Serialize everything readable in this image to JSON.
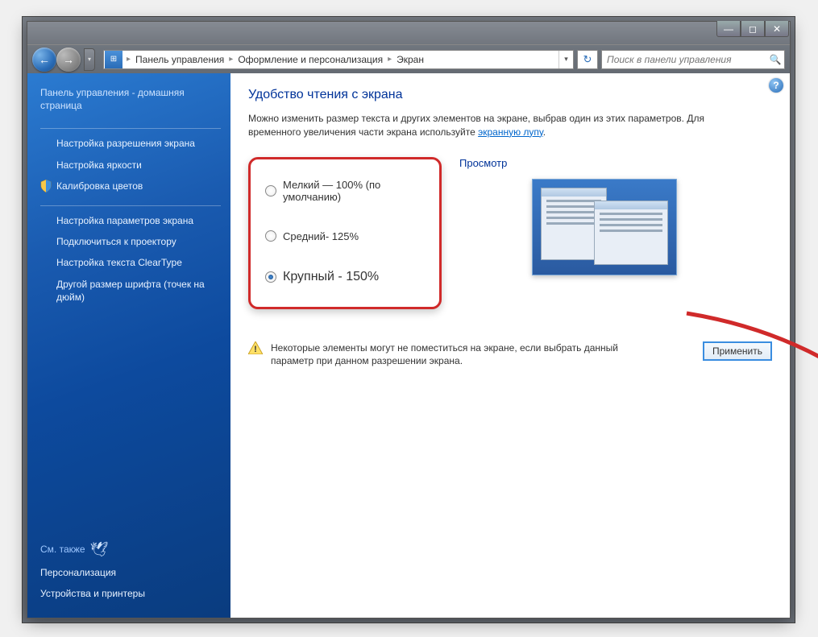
{
  "window_controls": {
    "min": "—",
    "max": "◻",
    "close": "✕"
  },
  "nav": {
    "back_glyph": "←",
    "forward_glyph": "→",
    "dropdown_glyph": "▾",
    "crumb1": "Панель управления",
    "crumb2": "Оформление и персонализация",
    "crumb3": "Экран",
    "refresh_glyph": "↻",
    "search_placeholder": "Поиск в панели управления",
    "search_glyph": "🔍"
  },
  "sidebar": {
    "home": "Панель управления - домашняя страница",
    "links": [
      "Настройка разрешения экрана",
      "Настройка яркости",
      "Калибровка цветов",
      "Настройка параметров экрана",
      "Подключиться к проектору",
      "Настройка текста ClearType",
      "Другой размер шрифта (точек на дюйм)"
    ],
    "see_also": "См. также",
    "bottom_links": [
      "Персонализация",
      "Устройства и принтеры"
    ]
  },
  "main": {
    "help_glyph": "?",
    "title": "Удобство чтения с экрана",
    "desc1": "Можно изменить размер текста и других элементов на экране, выбрав один из этих параметров. Для временного увеличения части экрана используйте ",
    "desc_link": "экранную лупу",
    "options": {
      "small": "Мелкий — 100% (по умолчанию)",
      "medium": "Средний- 125%",
      "large": "Крупный - 150%",
      "selected": "large"
    },
    "preview_label": "Просмотр",
    "warning": "Некоторые элементы могут не поместиться на экране, если выбрать данный параметр при данном разрешении экрана.",
    "apply": "Применить"
  }
}
